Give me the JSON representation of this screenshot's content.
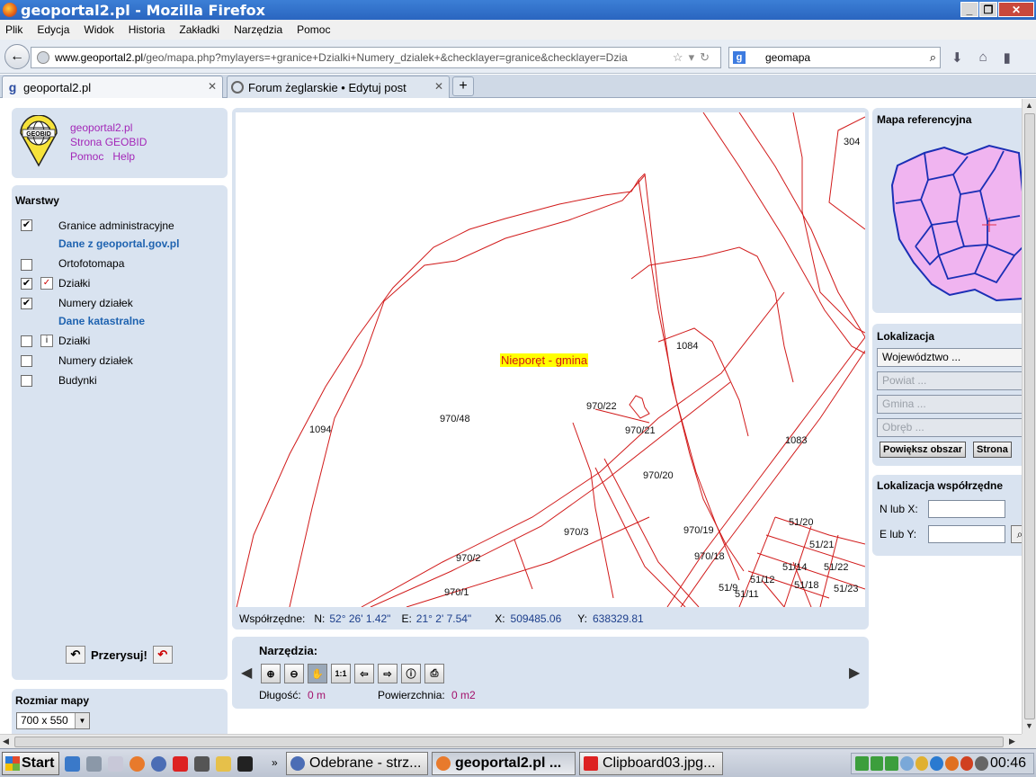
{
  "window": {
    "title": "geoportal2.pl - Mozilla Firefox",
    "min": "_",
    "max": "❐",
    "close": "✕"
  },
  "menu": [
    "Plik",
    "Edycja",
    "Widok",
    "Historia",
    "Zakładki",
    "Narzędzia",
    "Pomoc"
  ],
  "nav": {
    "url_host": "www.geoportal2.pl",
    "url_rest": "/geo/mapa.php?mylayers=+granice+Dzialki+Numery_dzialek+&checklayer=granice&checklayer=Dzia",
    "search_engine_icon": "google-icon",
    "search_value": "geomapa"
  },
  "tabs": [
    {
      "label": "geoportal2.pl",
      "active": true
    },
    {
      "label": "Forum żeglarskie • Edytuj post",
      "active": false
    }
  ],
  "logo": {
    "text": "GEOBID",
    "link1": "geoportal2.pl",
    "link2": "Strona GEOBID",
    "link3": "Pomoc",
    "link4": "Help"
  },
  "layers": {
    "title": "Warstwy",
    "items": [
      {
        "label": "Granice administracyjne",
        "checked": "✔"
      },
      {
        "label": "Ortofotomapa",
        "checked": ""
      },
      {
        "label": "Działki",
        "checked": "✔"
      },
      {
        "label": "Numery działek",
        "checked": "✔"
      },
      {
        "label": "Działki",
        "checked": ""
      },
      {
        "label": "Numery działek",
        "checked": ""
      },
      {
        "label": "Budynki",
        "checked": ""
      }
    ],
    "section1": "Dane z geoportal.gov.pl",
    "section2": "Dane katastralne",
    "redraw_label": "Przerysuj!"
  },
  "map_size": {
    "label": "Rozmiar mapy",
    "value": "700 x 550"
  },
  "map": {
    "gmina_label": "Nieporęt - gmina",
    "parcels": [
      "304",
      "1084",
      "1094",
      "970/48",
      "970/22",
      "970/21",
      "970/20",
      "1083",
      "970/3",
      "970/19",
      "970/2",
      "970/18",
      "970/1",
      "51/20",
      "51/21",
      "51/14",
      "51/22",
      "51/12",
      "51/18",
      "51/9",
      "51/11",
      "51/23"
    ]
  },
  "coords": {
    "label": "Współrzędne:",
    "n_label": "N:",
    "n_value": "52° 26' 1.42\"",
    "e_label": "E:",
    "e_value": "21° 2' 7.54\"",
    "x_label": "X:",
    "x_value": "509485.06",
    "y_label": "Y:",
    "y_value": "638329.81"
  },
  "tools": {
    "label": "Narzędzia:",
    "buttons": [
      "zoom-in-icon",
      "zoom-out-icon",
      "pan-hand-icon",
      "scale-1-1-icon",
      "back-icon",
      "forward-icon",
      "info-icon",
      "print-icon"
    ],
    "one_to_one": "1:1",
    "length_label": "Długość:",
    "length_value": "0 m",
    "area_label": "Powierzchnia:",
    "area_value": "0 m2"
  },
  "reference_map": {
    "label": "Mapa referencyjna"
  },
  "localization": {
    "label": "Lokalizacja",
    "voivodeship": "Województwo ...",
    "county": "Powiat ...",
    "commune": "Gmina ...",
    "precinct": "Obręb ...",
    "zoom_button": "Powiększ obszar",
    "page_button": "Strona"
  },
  "coord_localization": {
    "label": "Lokalizacja współrzędne",
    "n_label": "N lub X:",
    "e_label": "E lub Y:"
  },
  "taskbar": {
    "start": "Start",
    "tasks": [
      "Odebrane - strz...",
      "geoportal2.pl ...",
      "Clipboard03.jpg..."
    ],
    "clock": "00:46"
  }
}
